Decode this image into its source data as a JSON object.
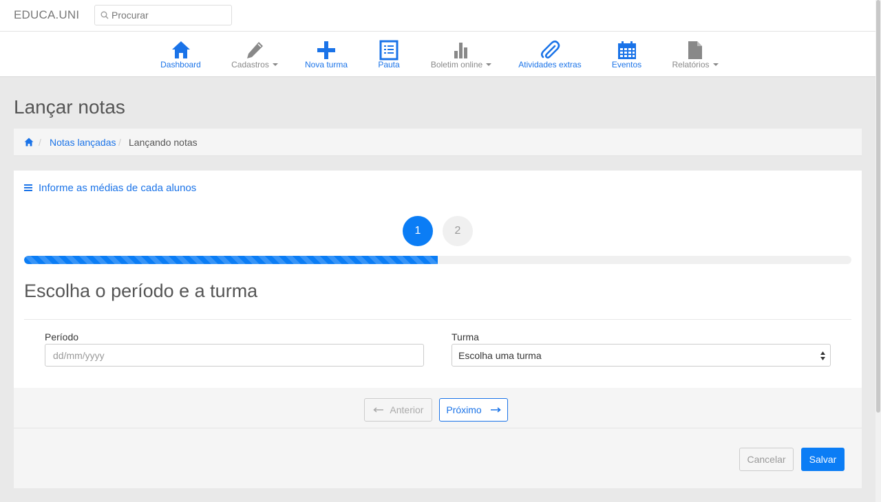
{
  "brand": "EDUCA.UNI",
  "search": {
    "placeholder": "Procurar"
  },
  "nav": {
    "dashboard": "Dashboard",
    "cadastros": "Cadastros",
    "nova_turma": "Nova turma",
    "pauta": "Pauta",
    "boletim": "Boletim online",
    "atividades": "Atividades extras",
    "eventos": "Eventos",
    "relatorios": "Relatórios"
  },
  "page_title": "Lançar notas",
  "breadcrumb": {
    "link": "Notas lançadas",
    "current": "Lançando notas",
    "separator": "/"
  },
  "panel": {
    "heading": "Informe as médias de cada alunos",
    "steps": [
      "1",
      "2"
    ],
    "progress_percent": 50,
    "step_title": "Escolha o período e a turma",
    "periodo_label": "Período",
    "periodo_placeholder": "dd/mm/yyyy",
    "turma_label": "Turma",
    "turma_value": "Escolha uma turma"
  },
  "wizard": {
    "prev": "Anterior",
    "next": "Próximo"
  },
  "actions": {
    "cancel": "Cancelar",
    "save": "Salvar"
  },
  "colors": {
    "accent": "#0b7df5",
    "link": "#1a73e8",
    "muted": "#888888"
  }
}
